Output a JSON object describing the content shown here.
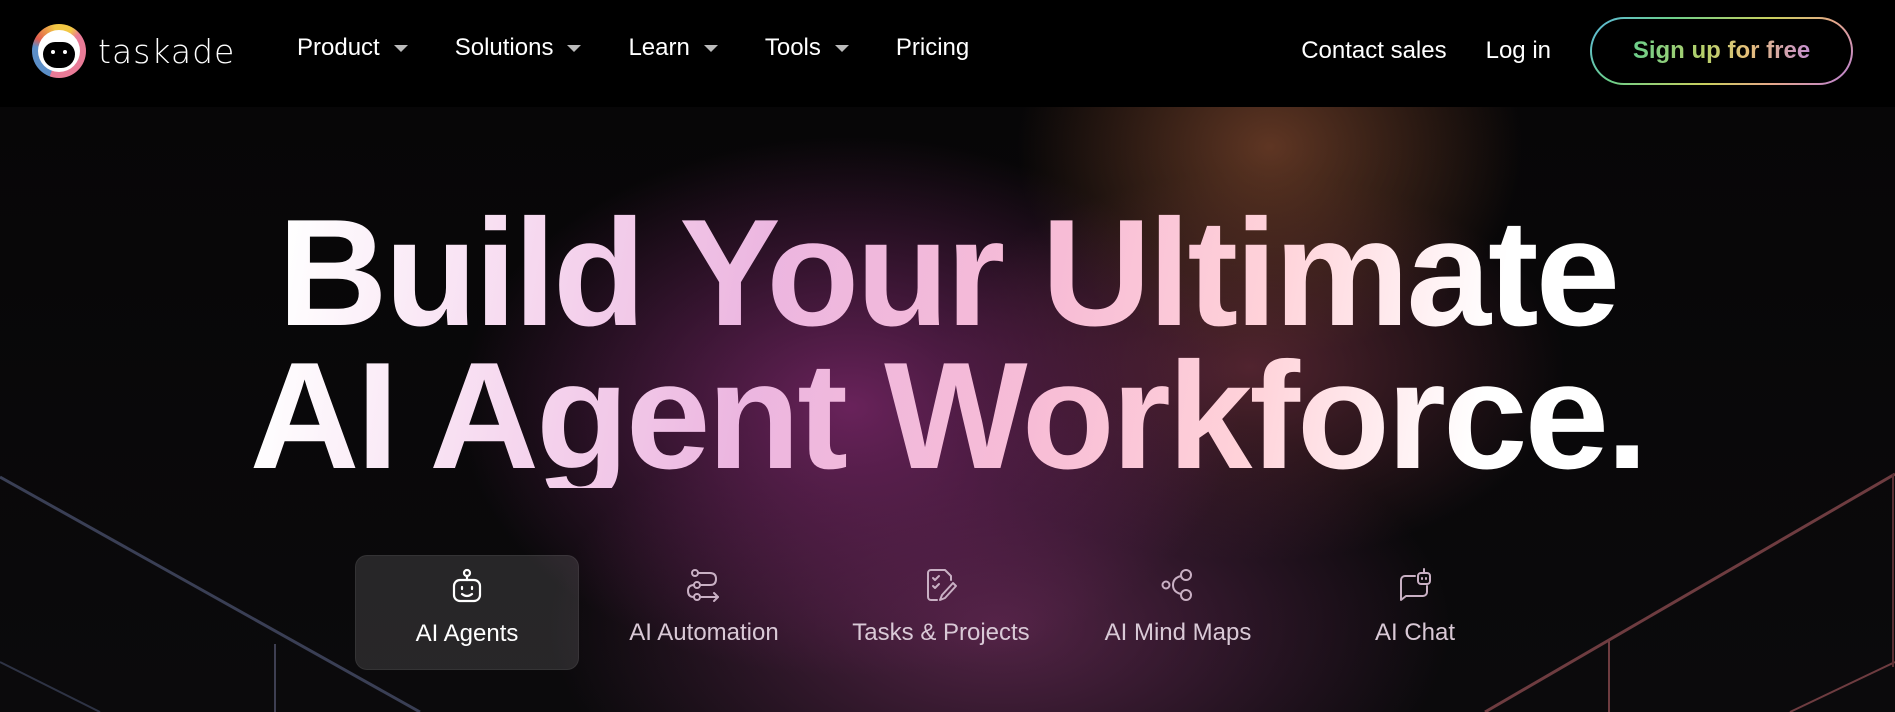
{
  "brand": {
    "name": "taskade",
    "logo_icon": "taskade-logo-icon"
  },
  "nav": {
    "items": [
      {
        "label": "Product",
        "has_dropdown": true
      },
      {
        "label": "Solutions",
        "has_dropdown": true
      },
      {
        "label": "Learn",
        "has_dropdown": true
      },
      {
        "label": "Tools",
        "has_dropdown": true
      },
      {
        "label": "Pricing",
        "has_dropdown": false
      }
    ],
    "contact_sales": "Contact sales",
    "login": "Log in",
    "signup": "Sign up for free"
  },
  "hero": {
    "headline_line1": "Build Your Ultimate",
    "headline_line2": "AI Agent Workforce."
  },
  "features": [
    {
      "label": "AI Agents",
      "icon": "robot-icon",
      "active": true
    },
    {
      "label": "AI Automation",
      "icon": "workflow-icon",
      "active": false
    },
    {
      "label": "Tasks & Projects",
      "icon": "checklist-edit-icon",
      "active": false
    },
    {
      "label": "AI Mind Maps",
      "icon": "share-nodes-icon",
      "active": false
    },
    {
      "label": "AI Chat",
      "icon": "chat-bot-icon",
      "active": false
    }
  ],
  "colors": {
    "background": "#000000",
    "signup_gradient": [
      "#5bb7e0",
      "#6ccf8b",
      "#c9cf5e",
      "#e6a88a",
      "#b87fd8"
    ],
    "hero_glow_purple": "#6e245f",
    "hero_glow_amber": "#6e3e28"
  }
}
